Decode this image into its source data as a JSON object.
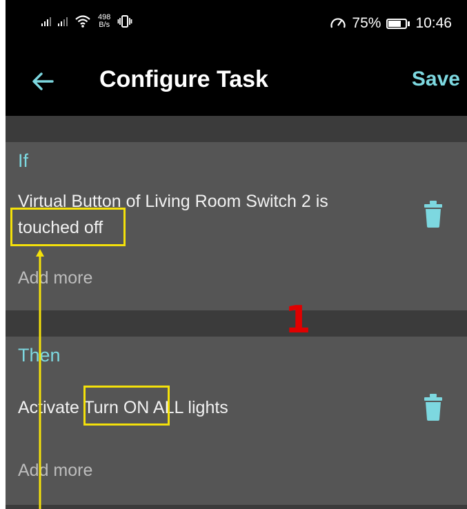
{
  "status_bar": {
    "net_speed_value": "498",
    "net_speed_unit": "B/s",
    "battery_percent": "75%",
    "battery_level": 0.75,
    "time": "10:46"
  },
  "toolbar": {
    "title": "Configure Task",
    "save_label": "Save"
  },
  "if_section": {
    "label": "If",
    "condition_line1": "Virtual Button of Living Room Switch 2 is",
    "condition_line2": "touched off",
    "add_more": "Add more"
  },
  "then_section": {
    "label": "Then",
    "action_prefix": "Activate ",
    "action_scene": "Turn ON",
    "action_suffix": " ALL lights",
    "add_more": "Add more"
  },
  "annotation": {
    "step_number": "1",
    "highlight_color": "#f4e10a",
    "number_color": "#e00000"
  },
  "colors": {
    "accent": "#7dd8e0",
    "section_bg": "#555555",
    "divider_bg": "#3b3b3b",
    "bar_bg": "#000000"
  }
}
